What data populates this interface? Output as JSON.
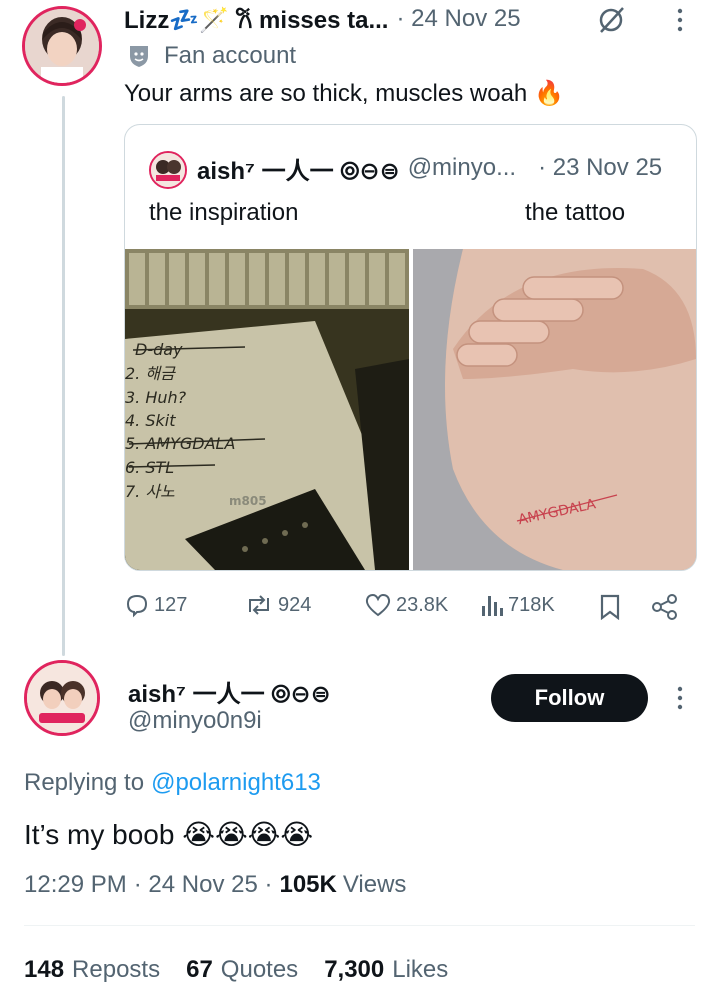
{
  "top_tweet": {
    "display_name": "Lizz💤🪄 𐙚 misses ta...",
    "date": "· 24 Nov 25",
    "badge_label": "Fan account",
    "text": "Your arms are so thick, muscles woah 🔥",
    "quote": {
      "display_name": "aish⁷ 一人一 ⦾⊖⊜",
      "handle": "@minyo...",
      "date": "· 23 Nov 25",
      "caption_left": "the inspiration",
      "caption_right": "the tattoo",
      "image_left_handwriting": [
        "D-day",
        "2. 해금",
        "3. Huh?",
        "4. Skit",
        "5. AMYGDALA",
        "6. STL",
        "7. 사노"
      ],
      "image_left_brand": "m805",
      "image_right_tattoo": "AMYGDALA"
    },
    "actions": {
      "replies": "127",
      "reposts": "924",
      "likes": "23.8K",
      "views": "718K"
    }
  },
  "main_tweet": {
    "display_name": "aish⁷ 一人一 ⦾⊖⊜",
    "handle": "@minyo0n9i",
    "follow_label": "Follow",
    "replying_prefix": "Replying to",
    "replying_handle": "@polarnight613",
    "text": "It’s my boob 😭😭😭😭",
    "time": "12:29 PM",
    "date": "· 24 Nov 25 ·",
    "views_count": "105K",
    "views_label": "Views"
  },
  "stats": {
    "reposts_count": "148",
    "reposts_label": "Reposts",
    "quotes_count": "67",
    "quotes_label": "Quotes",
    "likes_count": "7,300",
    "likes_label": "Likes"
  },
  "colors": {
    "accent": "#1d9bf0",
    "text": "#0f1419",
    "secondary": "#536471",
    "border": "#cfd9de"
  }
}
